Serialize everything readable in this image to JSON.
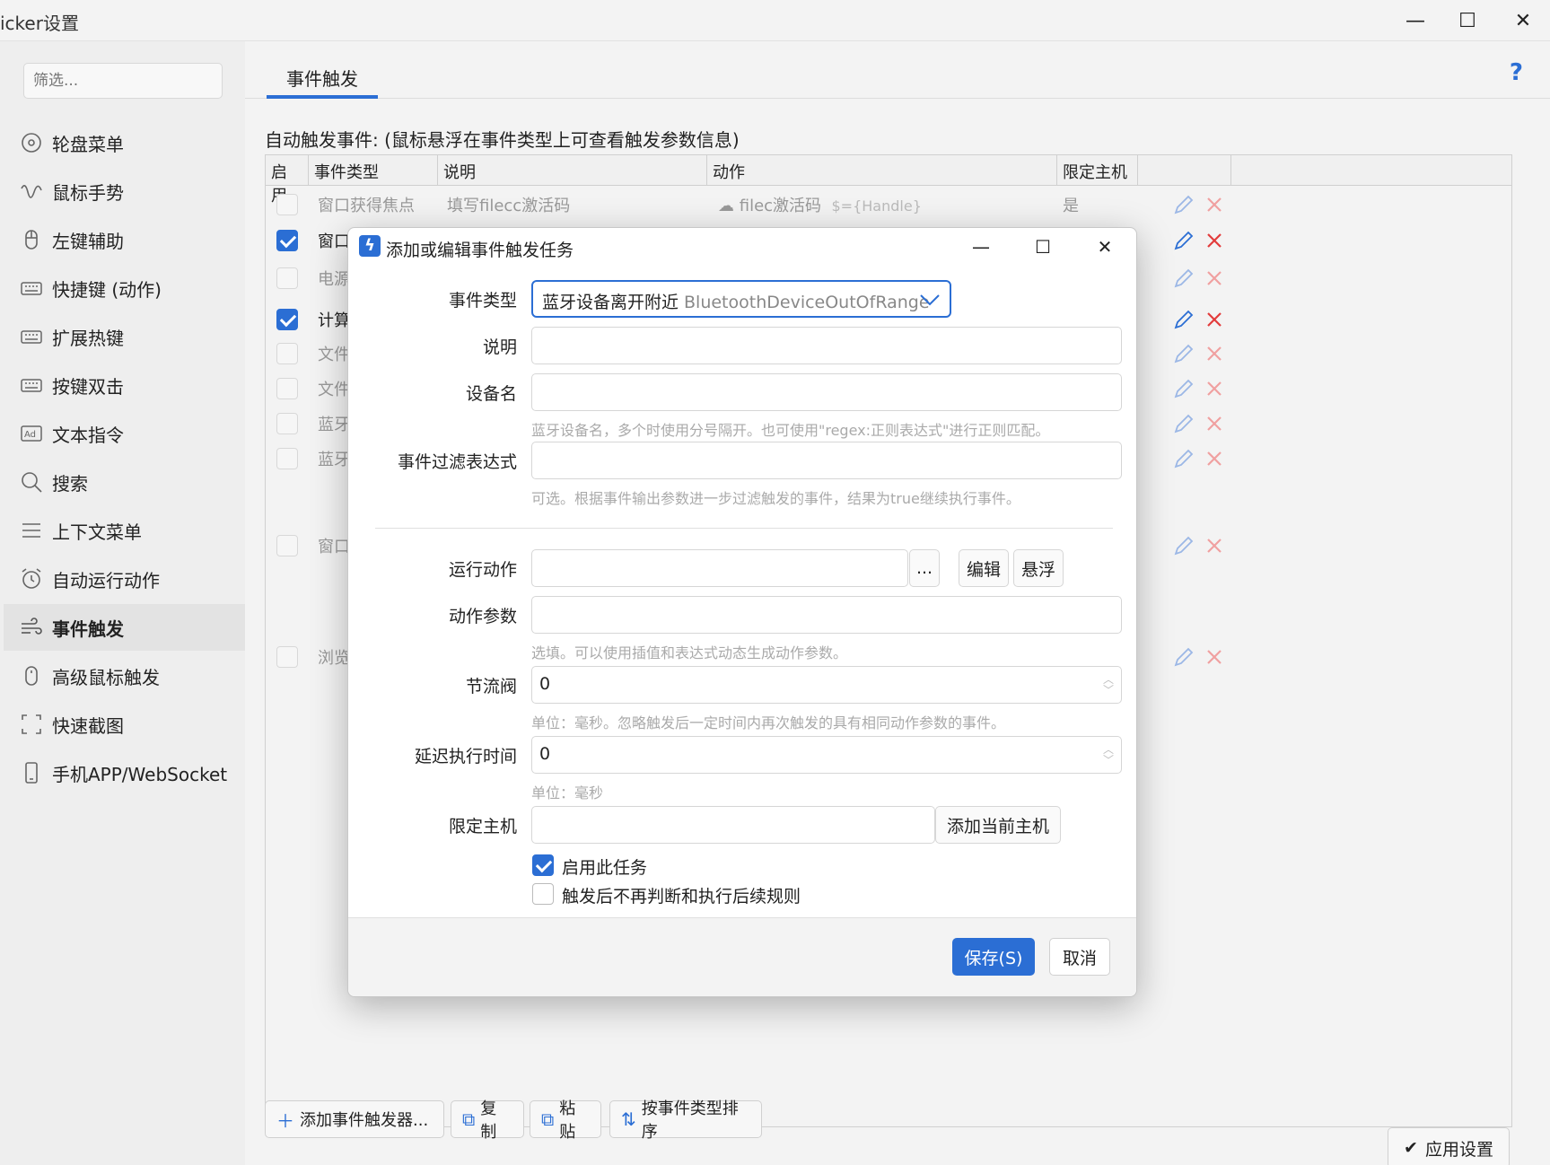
{
  "window": {
    "title": "icker设置",
    "minimize": "—",
    "maximize": "☐",
    "close": "✕"
  },
  "sidebar": {
    "filter_placeholder": "筛选...",
    "items": [
      {
        "label": "轮盘菜单",
        "icon": "wheel-icon"
      },
      {
        "label": "鼠标手势",
        "icon": "gesture-icon"
      },
      {
        "label": "左键辅助",
        "icon": "mouse-icon"
      },
      {
        "label": "快捷键 (动作)",
        "icon": "keyboard-icon"
      },
      {
        "label": "扩展热键",
        "icon": "keyboard-icon"
      },
      {
        "label": "按键双击",
        "icon": "keyboard-icon"
      },
      {
        "label": "文本指令",
        "icon": "ad-icon"
      },
      {
        "label": "搜索",
        "icon": "search-icon"
      },
      {
        "label": "上下文菜单",
        "icon": "menu-icon"
      },
      {
        "label": "自动运行动作",
        "icon": "alarm-icon"
      },
      {
        "label": "事件触发",
        "icon": "wind-icon"
      },
      {
        "label": "高级鼠标触发",
        "icon": "mouse-icon"
      },
      {
        "label": "快速截图",
        "icon": "screenshot-icon"
      },
      {
        "label": "手机APP/WebSocket",
        "icon": "phone-icon"
      }
    ],
    "active_index": 10
  },
  "main": {
    "tab_label": "事件触发",
    "help": "?",
    "section_title": "自动触发事件:  (鼠标悬浮在事件类型上可查看触发参数信息)",
    "table": {
      "headers": [
        "启用",
        "事件类型",
        "说明",
        "动作",
        "限定主机"
      ],
      "rows": [
        {
          "enabled": false,
          "type": "窗口获得焦点",
          "desc": "填写filecc激活码",
          "action": "filec激活码",
          "action_arg": "$={Handle}",
          "host": "是"
        },
        {
          "enabled": true,
          "type": "窗口",
          "desc": "",
          "action": "",
          "action_arg": "",
          "host": ""
        },
        {
          "enabled": false,
          "type": "电源",
          "desc": "",
          "action": "",
          "action_arg": "",
          "host": ""
        },
        {
          "enabled": true,
          "type": "计算",
          "desc": "",
          "action": "",
          "action_arg": "",
          "host": ""
        },
        {
          "enabled": false,
          "type": "文件",
          "desc": "",
          "action": "",
          "action_arg": "",
          "host": ""
        },
        {
          "enabled": false,
          "type": "文件",
          "desc": "",
          "action": "",
          "action_arg": "",
          "host": ""
        },
        {
          "enabled": false,
          "type": "蓝牙",
          "desc": "",
          "action": "",
          "action_arg": "",
          "host": ""
        },
        {
          "enabled": false,
          "type": "蓝牙",
          "desc": "",
          "action": "",
          "action_arg": "",
          "host": ""
        },
        {
          "enabled": false,
          "type": "窗口",
          "desc": "",
          "action": "",
          "action_arg": "",
          "host": ""
        },
        {
          "enabled": false,
          "type": "浏览",
          "desc": "",
          "action": "",
          "action_arg": "",
          "host": ""
        }
      ]
    },
    "buttons": {
      "add": "添加事件触发器...",
      "copy": "复制",
      "paste": "粘贴",
      "sort": "按事件类型排序",
      "apply": "应用设置"
    }
  },
  "dialog": {
    "title": "添加或编辑事件触发任务",
    "labels": {
      "event_type": "事件类型",
      "description": "说明",
      "device_name": "设备名",
      "filter_expr": "事件过滤表达式",
      "run_action": "运行动作",
      "action_params": "动作参数",
      "throttle": "节流阀",
      "delay": "延迟执行时间",
      "host": "限定主机"
    },
    "event_type_value": "蓝牙设备离开附近",
    "event_type_en": "BluetoothDeviceOutOfRange",
    "description_value": "",
    "device_name_value": "",
    "device_name_hint": "蓝牙设备名，多个时使用分号隔开。也可使用\"regex:正则表达式\"进行正则匹配。",
    "filter_expr_value": "",
    "filter_expr_hint": "可选。根据事件输出参数进一步过滤触发的事件，结果为true继续执行事件。",
    "run_action_value": "",
    "ellipsis": "...",
    "edit_button": "编辑",
    "float_button": "悬浮",
    "action_params_value": "",
    "action_params_hint": "选填。可以使用插值和表达式动态生成动作参数。",
    "throttle_value": "0",
    "throttle_hint": "单位：毫秒。忽略触发后一定时间内再次触发的具有相同动作参数的事件。",
    "delay_value": "0",
    "delay_hint": "单位：毫秒",
    "host_value": "",
    "add_host_button": "添加当前主机",
    "enable_task": {
      "label": "启用此任务",
      "checked": true
    },
    "stop_after": {
      "label": "触发后不再判断和执行后续规则",
      "checked": false
    },
    "save": "保存(S)",
    "cancel": "取消"
  },
  "colors": {
    "accent": "#2b6ed4",
    "delete": "#e23b3b"
  }
}
